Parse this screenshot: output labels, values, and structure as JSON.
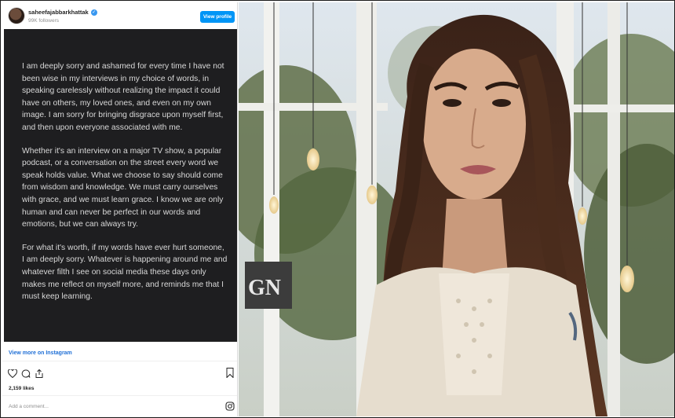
{
  "instagram": {
    "username": "saheefajabbarkhattak",
    "followers": "99K followers",
    "view_profile": "View profile",
    "post_paragraphs": [
      "I am deeply sorry and ashamed for every time I have not been wise in my interviews in my choice of words, in speaking carelessly without realizing the impact it could have on others, my loved ones, and even on my own image. I am sorry for bringing disgrace upon myself first, and then upon everyone associated with me.",
      "Whether it's an interview on a major TV show, a popular podcast, or a conversation on the street every word we speak holds value. What we choose to say should come from wisdom and knowledge. We must carry ourselves with grace, and we must learn grace. I know we are only human and can never be perfect in our words and emotions, but we can always try.",
      "For what it's worth, if my words have ever hurt someone, I am deeply sorry. Whatever is happening around me and whatever filth I see on social media these days only makes me reflect on myself more, and reminds me that I must keep learning."
    ],
    "view_more": "View more on Instagram",
    "likes": "2,159 likes",
    "comment_placeholder": "Add a comment...",
    "icons": [
      "heart-icon",
      "comment-icon",
      "share-icon",
      "bookmark-icon",
      "instagram-icon"
    ]
  },
  "photo": {
    "sign_fragment": "GN"
  },
  "colors": {
    "post_bg": "#1e1e20",
    "post_text": "#d9d9d9",
    "button_blue": "#0095f6",
    "link_blue": "#1f6fd6"
  }
}
